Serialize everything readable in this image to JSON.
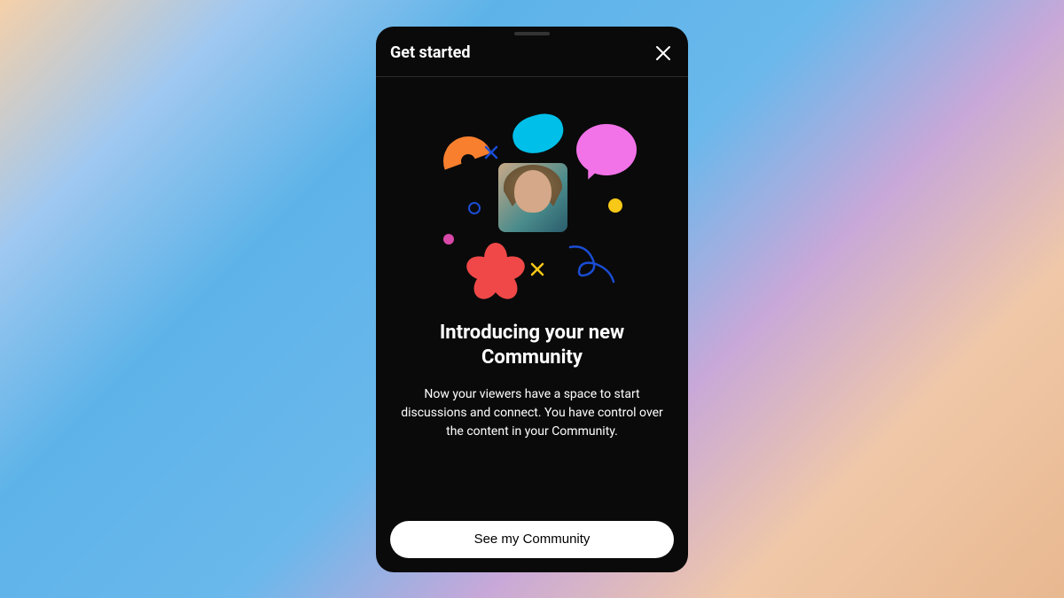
{
  "header": {
    "title": "Get started",
    "close_icon": "close"
  },
  "content": {
    "heading": "Introducing your new Community",
    "description": "Now your viewers have a space to start discussions and connect. You have control over the content in your Community."
  },
  "footer": {
    "cta_label": "See my Community"
  },
  "illustration": {
    "elements": [
      "avatar",
      "cyan-blob",
      "orange-arc",
      "pink-speech-bubble",
      "red-flower",
      "blue-x",
      "yellow-x",
      "blue-circle-outline",
      "magenta-dot",
      "yellow-dot",
      "blue-squiggle"
    ]
  },
  "colors": {
    "cyan": "#00bfe8",
    "orange": "#f77f2e",
    "pink": "#f272e8",
    "red": "#f04848",
    "blue": "#1a4dd4",
    "yellow": "#f7c817",
    "magenta": "#d848a8"
  }
}
